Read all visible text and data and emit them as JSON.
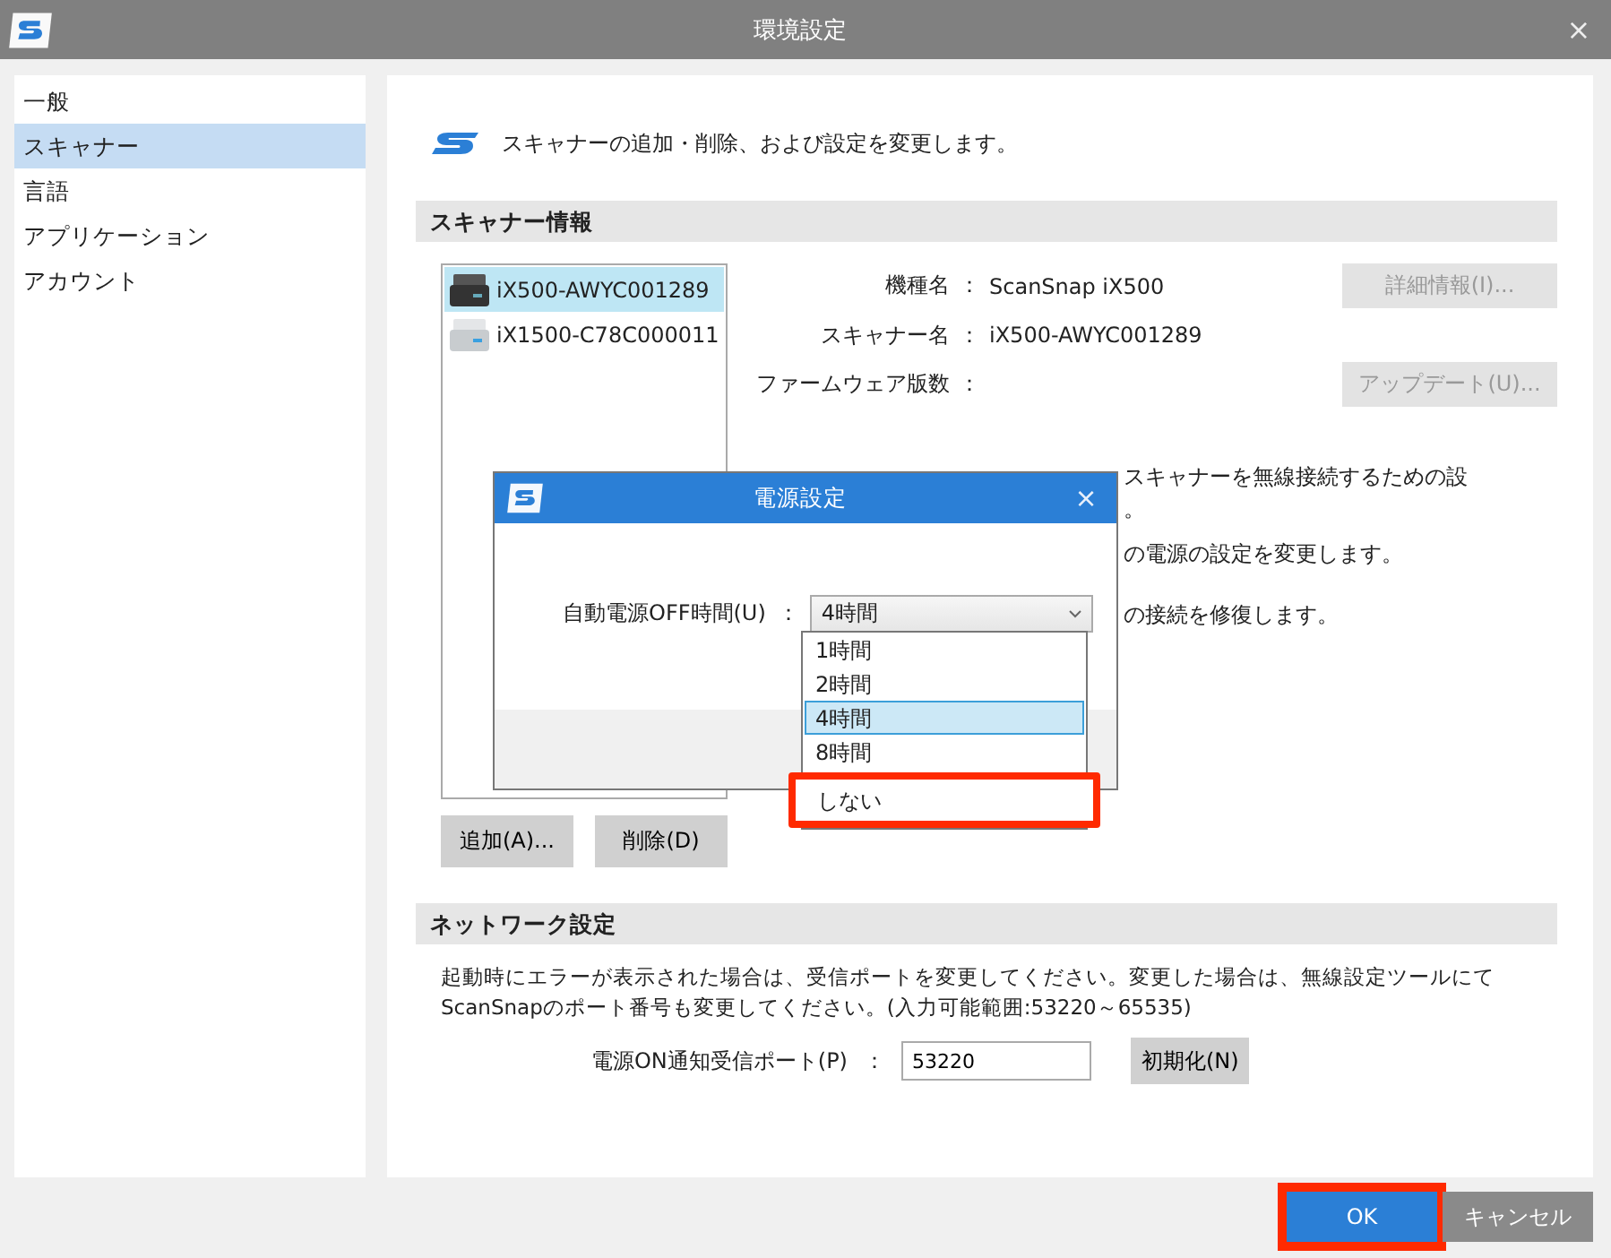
{
  "window": {
    "title": "環境設定",
    "close": "×"
  },
  "sidebar": {
    "items": [
      {
        "label": "一般",
        "selected": false
      },
      {
        "label": "スキャナー",
        "selected": true
      },
      {
        "label": "言語",
        "selected": false
      },
      {
        "label": "アプリケーション",
        "selected": false
      },
      {
        "label": "アカウント",
        "selected": false
      }
    ]
  },
  "header": {
    "text": "スキャナーの追加・削除、および設定を変更します。"
  },
  "scanner_section": {
    "title": "スキャナー情報",
    "scanners": [
      {
        "name": "iX500-AWYC001289",
        "kind": "dark",
        "selected": true
      },
      {
        "name": "iX1500-C78C000011",
        "kind": "light",
        "selected": false
      }
    ],
    "info": [
      {
        "label": "機種名",
        "separator": "：",
        "value": "ScanSnap iX500",
        "button": {
          "label": "詳細情報(I)...",
          "disabled": true
        }
      },
      {
        "label": "スキャナー名",
        "separator": "：",
        "value": "iX500-AWYC001289"
      },
      {
        "label": "ファームウェア版数",
        "separator": "：",
        "button": {
          "label": "アップデート(U)...",
          "disabled": true
        }
      }
    ],
    "descriptions": [
      "スキャナーを無線接続するための設",
      "。",
      "の電源の設定を変更します。",
      "の接続を修復します。"
    ],
    "list_buttons": [
      "追加(A)...",
      "削除(D)"
    ]
  },
  "network_section": {
    "title": "ネットワーク設定",
    "note": "起動時にエラーが表示された場合は、受信ポートを変更してください。変更した場合は、無線設定ツールにてScanSnapのポート番号も変更してください。(入力可能範囲:53220～65535)",
    "port": {
      "label": "電源ON通知受信ポート(P)",
      "separator": "：",
      "value": "53220"
    },
    "reset_button": "初期化(N)"
  },
  "dialog": {
    "title": "電源設定",
    "close": "×",
    "field": {
      "label": "自動電源OFF時間(U)",
      "separator": "：",
      "value": "4時間"
    },
    "options": [
      {
        "label": "1時間",
        "selected": false,
        "highlighted": false
      },
      {
        "label": "2時間",
        "selected": false,
        "highlighted": false
      },
      {
        "label": "4時間",
        "selected": true,
        "highlighted": false
      },
      {
        "label": "8時間",
        "selected": false,
        "highlighted": false
      },
      {
        "label": "しない",
        "selected": false,
        "highlighted": true
      }
    ]
  },
  "footer_buttons": [
    {
      "label": "OK",
      "kind": "primary",
      "highlighted": true
    },
    {
      "label": "キャンセル",
      "kind": "secondary",
      "highlighted": false
    }
  ]
}
